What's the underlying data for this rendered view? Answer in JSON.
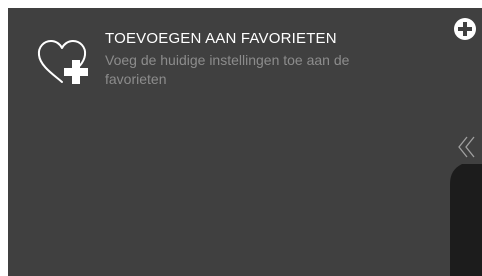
{
  "favorites": {
    "title": "TOEVOEGEN AAN FAVORIETEN",
    "description": "Voeg de huidige instellingen toe aan de favorieten",
    "icon": "heart-plus-icon"
  },
  "toolbar": {
    "add_icon": "plus-circle-icon",
    "collapse_icon": "double-chevron-left-icon"
  },
  "colors": {
    "background": "#404040",
    "text_primary": "#ffffff",
    "text_secondary": "#8c8c8c",
    "side_panel": "#1c1c1c"
  }
}
